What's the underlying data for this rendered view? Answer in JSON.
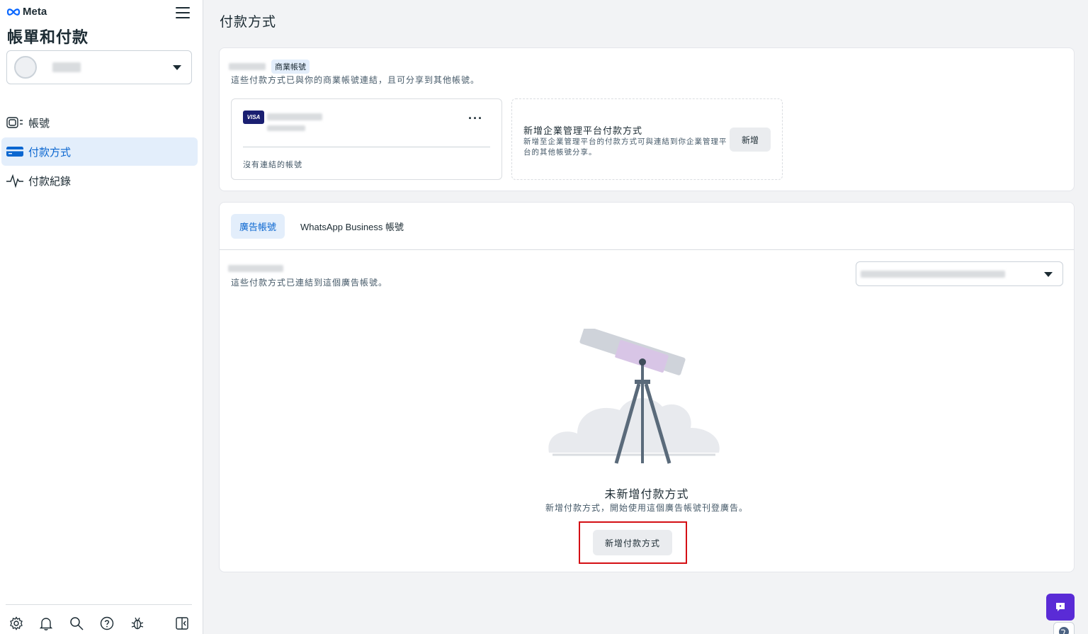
{
  "brand": {
    "name": "Meta"
  },
  "sidebar": {
    "title": "帳單和付款",
    "nav": [
      {
        "label": "帳號",
        "icon": "accounts-icon"
      },
      {
        "label": "付款方式",
        "icon": "credit-card-icon",
        "active": true
      },
      {
        "label": "付款紀錄",
        "icon": "activity-icon"
      }
    ],
    "bottom_icons": [
      "settings-icon",
      "bell-icon",
      "search-icon",
      "help-icon",
      "bug-icon",
      "panel-toggle-icon"
    ]
  },
  "main": {
    "page_title": "付款方式",
    "business_card": {
      "badge": "商業帳號",
      "description": "這些付款方式已與你的商業帳號連結，且可分享到其他帳號。",
      "payment_method": {
        "brand": "VISA",
        "more_label": "···",
        "note": "沒有連結的帳號"
      },
      "add_platform": {
        "title": "新增企業管理平台付款方式",
        "description": "新增至企業管理平台的付款方式可與連結到你企業管理平台的其他帳號分享。",
        "button": "新增"
      }
    },
    "accounts_card": {
      "tabs": [
        {
          "label": "廣告帳號",
          "active": true
        },
        {
          "label": "WhatsApp Business 帳號",
          "active": false
        }
      ],
      "description": "這些付款方式已連結到這個廣告帳號。",
      "empty_state": {
        "title": "未新增付款方式",
        "description": "新增付款方式，開始使用這個廣告帳號刊登廣告。",
        "button": "新增付款方式"
      }
    }
  },
  "colors": {
    "accent": "#0a66d0",
    "active_bg": "#e3eefb",
    "highlight": "#d40f14",
    "chat": "#5a2bd6"
  }
}
